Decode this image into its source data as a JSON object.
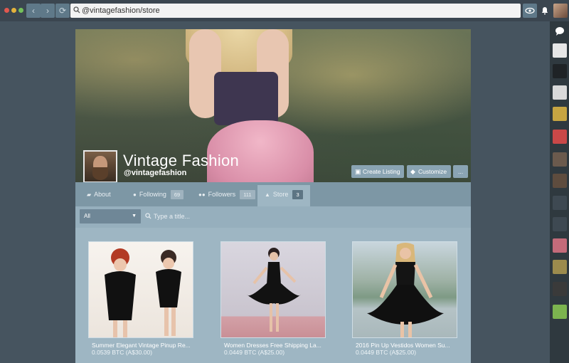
{
  "browser": {
    "url": "@vintagefashion/store",
    "back_icon": "chevron-left-icon",
    "forward_icon": "chevron-right-icon",
    "refresh_icon": "refresh-icon"
  },
  "profile": {
    "title": "Vintage Fashion",
    "handle": "@vintagefashion",
    "buttons": {
      "create_listing": "Create Listing",
      "customize": "Customize",
      "more": "..."
    }
  },
  "tabs": [
    {
      "label": "About",
      "icon": "chat-icon",
      "count": ""
    },
    {
      "label": "Following",
      "icon": "user-icon",
      "count": "69"
    },
    {
      "label": "Followers",
      "icon": "users-icon",
      "count": "111"
    },
    {
      "label": "Store",
      "icon": "cart-icon",
      "count": "3",
      "active": true
    }
  ],
  "filter": {
    "category_selected": "All",
    "search_placeholder": "Type a title..."
  },
  "listings": [
    {
      "name": "Summer Elegant Vintage Pinup Re...",
      "price": "0.0539 BTC (A$30.00)"
    },
    {
      "name": "Women Dresses Free Shipping La...",
      "price": "0.0449 BTC (A$25.00)"
    },
    {
      "name": "2016 Pin Up Vestidos Women Su...",
      "price": "0.0449 BTC (A$25.00)"
    }
  ],
  "colors": {
    "accent": "#9eb6c3",
    "tab_bar": "#7d97a5",
    "chrome": "#3b4650"
  }
}
